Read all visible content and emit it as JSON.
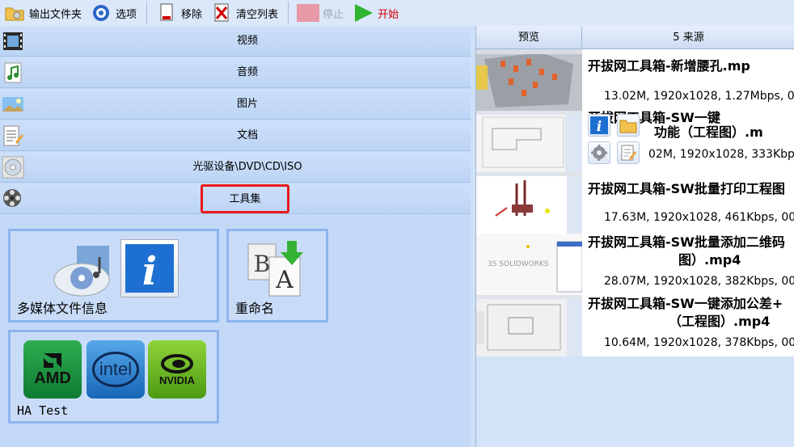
{
  "toolbar": {
    "output_folder": "输出文件夹",
    "options": "选项",
    "remove": "移除",
    "clear_list": "清空列表",
    "stop": "停止",
    "start": "开始"
  },
  "categories": [
    {
      "label": "视频"
    },
    {
      "label": "音频"
    },
    {
      "label": "图片"
    },
    {
      "label": "文档"
    },
    {
      "label": "光驱设备\\DVD\\CD\\ISO"
    },
    {
      "label": "工具集"
    }
  ],
  "tools": {
    "media_info": {
      "label": "多媒体文件信息"
    },
    "rename": {
      "label": "重命名"
    },
    "ha_test": {
      "label": "HA Test",
      "brands": [
        "AMD",
        "intel",
        "NVIDIA"
      ]
    }
  },
  "file_list": {
    "col_preview": "预览",
    "col_source": "5 来源",
    "files": [
      {
        "title": "开拔网工具箱-新增腰孔.mp",
        "title2": "",
        "meta": "13.02M, 1920x1028, 1.27Mbps, 00"
      },
      {
        "title": "开拔网工具箱-SW一键",
        "title2": "功能（工程图）.m",
        "meta": "02M, 1920x1028, 333Kbp"
      },
      {
        "title": "开拔网工具箱-SW批量打印工程图",
        "title2": "",
        "meta": "17.63M, 1920x1028, 461Kbps, 00:"
      },
      {
        "title": "开拔网工具箱-SW批量添加二维码",
        "title2": "图）.mp4",
        "meta": "28.07M, 1920x1028, 382Kbps, 00:"
      },
      {
        "title": "开拔网工具箱-SW一键添加公差+",
        "title2": "（工程图）.mp4",
        "meta": "10.64M, 1920x1028, 378Kbps, 00"
      }
    ]
  },
  "colors": {
    "highlight_border": "#e8191b",
    "start_text": "#d40000",
    "panel_bg": "#c3d9f7",
    "tile_border": "#8eb4ee"
  }
}
